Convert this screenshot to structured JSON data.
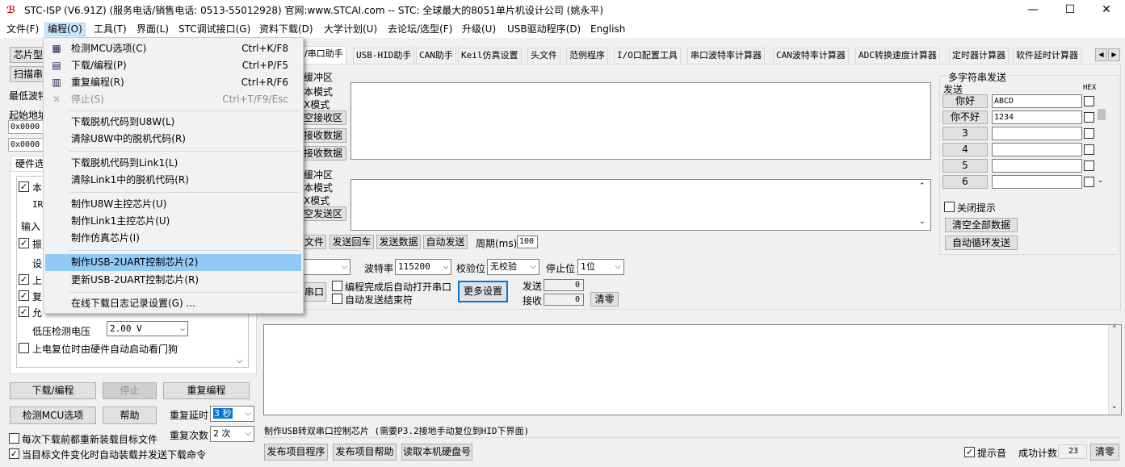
{
  "window": {
    "title": "STC-ISP (V6.91Z) (服务电话/销售电话: 0513-55012928) 官网:www.STCAI.com  -- STC: 全球最大的8051单片机设计公司 (姚永平)",
    "minimize_glyph": "—",
    "maximize_glyph": "☐",
    "close_glyph": "✕",
    "app_icon_glyph": "ℬ"
  },
  "menubar": {
    "items": [
      "文件(F)",
      "编程(O)",
      "工具(T)",
      "界面(L)",
      "STC调试接口(G)",
      "资料下载(D)",
      "大学计划(U)",
      "去论坛/选型(F)",
      "升级(U)",
      "USB驱动程序(D)",
      "English"
    ]
  },
  "dropdown": {
    "items": [
      {
        "label": "检测MCU选项(C)",
        "shortcut": "Ctrl+K/F8",
        "icon": "chip-icon",
        "glyph": "▦"
      },
      {
        "label": "下载/编程(P)",
        "shortcut": "Ctrl+P/F5",
        "icon": "download-icon",
        "glyph": "▤"
      },
      {
        "label": "重复编程(R)",
        "shortcut": "Ctrl+R/F6",
        "icon": "repeat-icon",
        "glyph": "▥"
      },
      {
        "label": "停止(S)",
        "shortcut": "Ctrl+T/F9/Esc",
        "icon": "stop-icon",
        "glyph": "✕"
      },
      {
        "label": "下载脱机代码到U8W(L)"
      },
      {
        "label": "清除U8W中的脱机代码(R)"
      },
      {
        "label": "下载脱机代码到Link1(L)"
      },
      {
        "label": "清除Link1中的脱机代码(R)"
      },
      {
        "label": "制作U8W主控芯片(U)"
      },
      {
        "label": "制作Link1主控芯片(U)"
      },
      {
        "label": "制作仿真芯片(I)"
      },
      {
        "label": "制作USB-2UART控制芯片(2)"
      },
      {
        "label": "更新USB-2UART控制芯片(R)"
      },
      {
        "label": "在线下载日志记录设置(G) ..."
      }
    ]
  },
  "left": {
    "chip_type_btn": "芯片型",
    "scan_btn": "扫描串",
    "min_baud_label": "最低波特",
    "start_addr_label": "起始地址",
    "addr1": "0x0000",
    "addr2": "0x0000",
    "hw_tab": "硬件选",
    "partial_labels": [
      "本",
      "IR",
      "输入",
      "振",
      "设",
      "上",
      "复",
      "允"
    ],
    "low_voltage_label": "低压检测电压",
    "low_voltage_value": "2.00 V",
    "watchdog_label": "上电复位时由硬件自动启动看门狗",
    "download_btn": "下载/编程",
    "stop_btn": "停止",
    "reprogram_btn": "重复编程",
    "detect_btn": "检测MCU选项",
    "help_btn": "帮助",
    "repeat_delay_label": "重复延时",
    "repeat_delay_value": "3 秒",
    "repeat_count_label": "重复次数",
    "repeat_count_value": "2 次",
    "reload_label": "每次下载前都重新装载目标文件",
    "auto_send_label": "当目标文件变化时自动装载并发送下载命令"
  },
  "tabs": [
    "/串口助手",
    "USB-HID助手",
    "CAN助手",
    "Keil仿真设置",
    "头文件",
    "范例程序",
    "I/O口配置工具",
    "串口波特率计算器",
    "CAN波特率计算器",
    "ADC转换速度计算器",
    "定时器计算器",
    "软件延时计算器"
  ],
  "tab_scroll": {
    "left": "◀",
    "right": "▶"
  },
  "serial": {
    "recv_label": "缓冲区",
    "text_mode": "本模式",
    "hex_mode": "X模式",
    "clear_recv": "空接收区",
    "save_recv": "接收数据",
    "copy_recv": "接收数据",
    "send_label": "缓冲区",
    "send_text_mode": "本模式",
    "send_hex_mode": "X模式",
    "clear_send": "空发送区",
    "send_file_btn": "文件",
    "send_cr_btn": "发送回车",
    "send_data_btn": "发送数据",
    "auto_send_btn": "自动发送",
    "period_label": "周期(ms)",
    "period_value": "100",
    "baud_label": "波特率",
    "baud_value": "115200",
    "parity_label": "校验位",
    "parity_value": "无校验",
    "stop_label": "停止位",
    "stop_value": "1位",
    "open_port_btn": "串口",
    "auto_open_label": "编程完成后自动打开串口",
    "auto_end_label": "自动发送结束符",
    "more_settings_btn": "更多设置",
    "sent_label": "发送",
    "sent_value": "0",
    "recv_count_label": "接收",
    "recv_count_value": "0",
    "clear_count_btn": "清零"
  },
  "multi": {
    "title": "多字符串发送",
    "send_col": "发送",
    "hex_col": "HEX",
    "rows": [
      {
        "btn": "你好",
        "value": "ABCD"
      },
      {
        "btn": "你不好",
        "value": "1234"
      },
      {
        "btn": "3",
        "value": ""
      },
      {
        "btn": "4",
        "value": ""
      },
      {
        "btn": "5",
        "value": ""
      },
      {
        "btn": "6",
        "value": ""
      }
    ],
    "close_tip_label": "关闭提示",
    "clear_all_btn": "清空全部数据",
    "auto_loop_btn": "自动循环发送"
  },
  "status": {
    "message": "制作USB转双串口控制芯片 (需要P3.2接地手动复位到HID下界面)",
    "publish_btn": "发布项目程序",
    "publish_help_btn": "发布项目帮助",
    "read_disk_btn": "读取本机硬盘号",
    "beep_label": "提示音",
    "success_label": "成功计数",
    "success_value": "23",
    "clear_btn": "清零"
  }
}
